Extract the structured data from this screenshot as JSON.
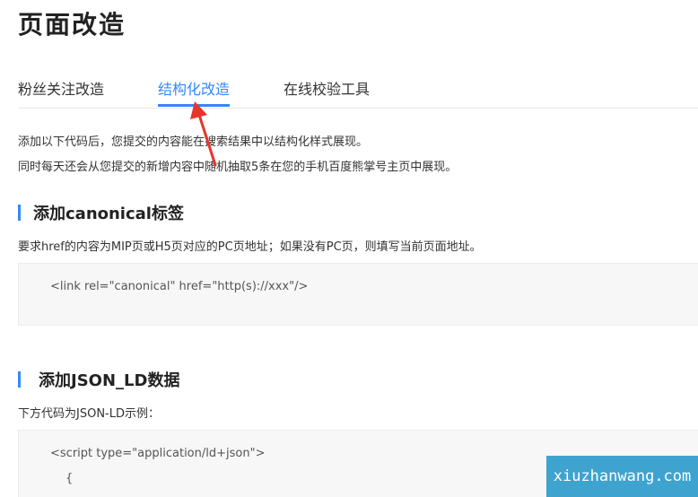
{
  "page_title": "页面改造",
  "tabs": [
    {
      "label": "粉丝关注改造",
      "active": false
    },
    {
      "label": "结构化改造",
      "active": true
    },
    {
      "label": "在线校验工具",
      "active": false
    }
  ],
  "intro": {
    "line1": "添加以下代码后，您提交的内容能在搜索结果中以结构化样式展现。",
    "line2": "同时每天还会从您提交的新增内容中随机抽取5条在您的手机百度熊掌号主页中展现。"
  },
  "sections": [
    {
      "title": "添加canonical标签",
      "desc": "要求href的内容为MIP页或H5页对应的PC页地址；如果没有PC页，则填写当前页面地址。",
      "code_lines": [
        "<link rel=\"canonical\" href=\"http(s)://xxx\"/>"
      ]
    },
    {
      "title": "添加JSON_LD数据",
      "desc": "下方代码为JSON-LD示例：",
      "code_lines": [
        "<script type=\"application/ld+json\">",
        "{"
      ]
    }
  ],
  "watermark": "xiuzhanwang.com",
  "colors": {
    "accent": "#3388ff",
    "arrow": "#e8352c",
    "watermark_bg": "#3fa3cf"
  }
}
